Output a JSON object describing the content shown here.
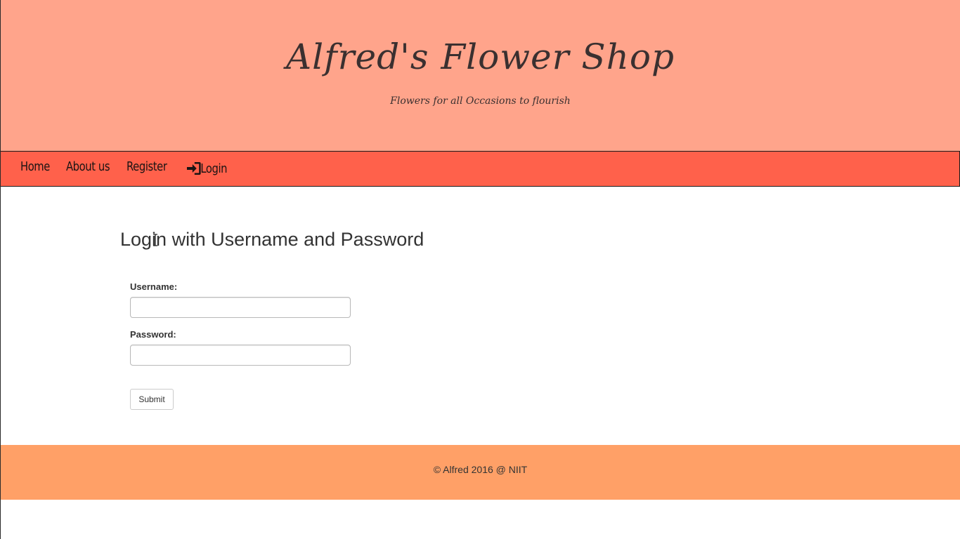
{
  "header": {
    "title": "Alfred's Flower Shop",
    "tagline": "Flowers for all Occasions to flourish"
  },
  "nav": {
    "items": [
      {
        "label": "Home"
      },
      {
        "label": "About us"
      },
      {
        "label": "Register"
      },
      {
        "label": "Login",
        "icon": "log-in-icon"
      }
    ]
  },
  "login": {
    "heading": "Login with Username and Password",
    "username_label": "Username:",
    "username_value": "",
    "password_label": "Password:",
    "password_value": "",
    "submit_label": "Submit"
  },
  "footer": {
    "text": "© Alfred 2016 @ NIIT"
  },
  "colors": {
    "header_bg": "#ffa48b",
    "nav_bg": "#ff614b",
    "footer_bg": "#ffa067",
    "text": "#333333"
  }
}
